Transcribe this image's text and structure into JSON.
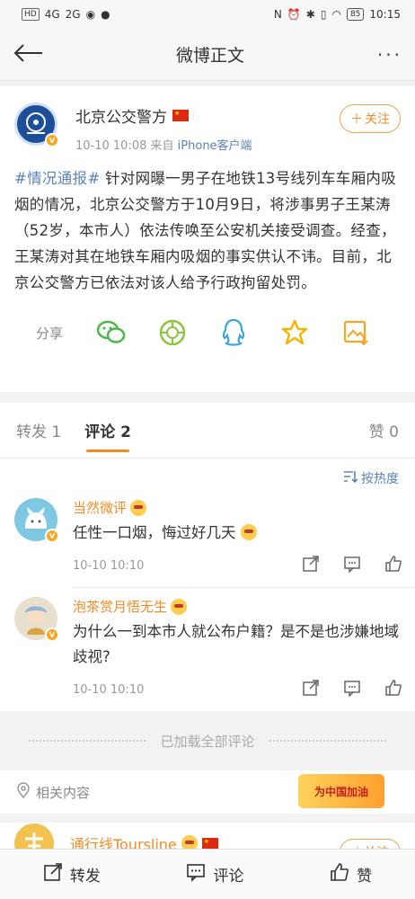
{
  "status_bar": {
    "left": [
      "HD",
      "4G",
      "2G"
    ],
    "battery": "85",
    "time": "10:15"
  },
  "nav": {
    "title": "微博正文",
    "more": "···"
  },
  "post": {
    "author": "北京公交警方",
    "time": "10-10 10:08",
    "source_prefix": "来自",
    "source": "iPhone客户端",
    "follow_label": "关注",
    "tag": "#情况通报#",
    "text": " 针对网曝一男子在地铁13号线列车车厢内吸烟的情况，北京公交警方于10月9日，将涉事男子王某涛（52岁，本市人）依法传唤至公安机关接受调查。经查，王某涛对其在地铁车厢内吸烟的事实供认不讳。目前，北京公交警方已依法对该人给予行政拘留处罚。",
    "share_label": "分享",
    "share_icons": [
      "wechat-icon",
      "moments-icon",
      "qq-icon",
      "qzone-icon",
      "save-image-icon"
    ]
  },
  "tabs": {
    "repost": "转发 1",
    "comment": "评论 2",
    "like": "赞 0"
  },
  "sort_label": "按热度",
  "comments": [
    {
      "name": "当然微评",
      "text": "任性一口烟，悔过好几天",
      "time": "10-10 10:10"
    },
    {
      "name": "泡茶赏月悟无生",
      "text": "为什么一到本市人就公布户籍？是不是也涉嫌地域歧视?",
      "time": "10-10 10:10"
    }
  ],
  "loaded_all": "已加载全部评论",
  "related": {
    "label": "相关内容",
    "banner": "为中国加油",
    "item_name": "通行线Toursline",
    "item_follow": "关注"
  },
  "bottom_bar": {
    "repost": "转发",
    "comment": "评论",
    "like": "赞"
  },
  "colors": {
    "accent": "#f28c28",
    "link": "#5b83b8"
  }
}
